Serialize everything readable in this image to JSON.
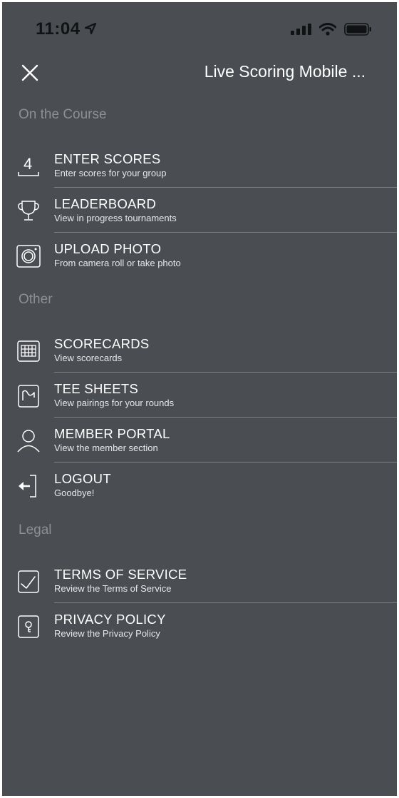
{
  "status_bar": {
    "time": "11:04"
  },
  "nav": {
    "title": "Live Scoring Mobile ..."
  },
  "sections": {
    "on_course": {
      "title": "On the Course",
      "items": [
        {
          "title": "ENTER SCORES",
          "subtitle": "Enter scores for your group",
          "icon": "enter-scores-icon",
          "icon_glyph": "4"
        },
        {
          "title": "LEADERBOARD",
          "subtitle": "View in progress tournaments",
          "icon": "trophy-icon"
        },
        {
          "title": "UPLOAD PHOTO",
          "subtitle": "From camera roll or take photo",
          "icon": "camera-icon"
        }
      ]
    },
    "other": {
      "title": "Other",
      "items": [
        {
          "title": "SCORECARDS",
          "subtitle": "View scorecards",
          "icon": "scorecard-grid-icon"
        },
        {
          "title": "TEE SHEETS",
          "subtitle": "View pairings for your rounds",
          "icon": "tee-sheet-icon"
        },
        {
          "title": "MEMBER PORTAL",
          "subtitle": "View the member section",
          "icon": "user-icon"
        },
        {
          "title": "LOGOUT",
          "subtitle": "Goodbye!",
          "icon": "logout-icon"
        }
      ]
    },
    "legal": {
      "title": "Legal",
      "items": [
        {
          "title": "TERMS OF SERVICE",
          "subtitle": "Review the Terms of Service",
          "icon": "terms-checkmark-icon"
        },
        {
          "title": "PRIVACY POLICY",
          "subtitle": "Review the Privacy Policy",
          "icon": "privacy-lock-icon"
        }
      ]
    }
  },
  "colors": {
    "background": "#4a4d52",
    "section_header": "#8c8f94",
    "text": "#ffffff",
    "divider": "#7d8085"
  }
}
